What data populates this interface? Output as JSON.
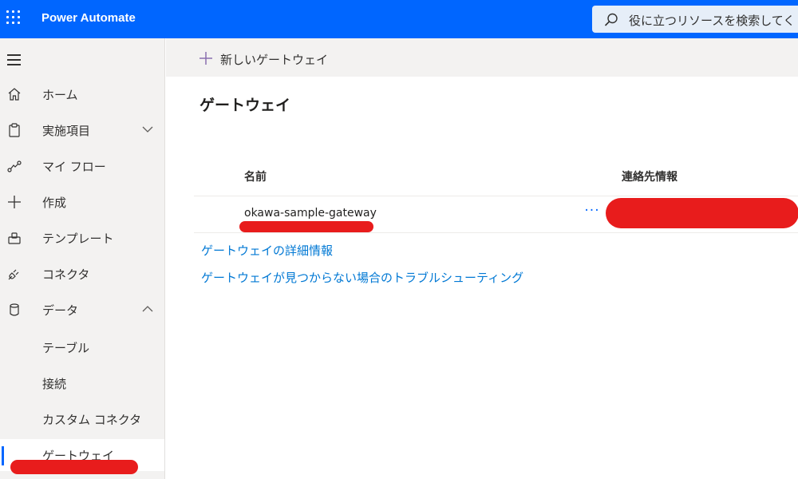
{
  "app": {
    "title": "Power Automate"
  },
  "search": {
    "placeholder": "役に立つリソースを検索してく"
  },
  "sidebar": {
    "items": [
      {
        "label": "ホーム"
      },
      {
        "label": "実施項目"
      },
      {
        "label": "マイ フロー"
      },
      {
        "label": "作成"
      },
      {
        "label": "テンプレート"
      },
      {
        "label": "コネクタ"
      },
      {
        "label": "データ"
      },
      {
        "label": "テーブル"
      },
      {
        "label": "接続"
      },
      {
        "label": "カスタム コネクタ"
      },
      {
        "label": "ゲートウェイ"
      }
    ]
  },
  "toolbar": {
    "new_gateway_label": "新しいゲートウェイ"
  },
  "main": {
    "title": "ゲートウェイ",
    "columns": {
      "name": "名前",
      "contact": "連絡先情報"
    },
    "rows": [
      {
        "name": "okawa-sample-gateway",
        "more": "···"
      }
    ],
    "links": {
      "details": "ゲートウェイの詳細情報",
      "troubleshoot": "ゲートウェイが見つからない場合のトラブルシューティング"
    }
  },
  "colors": {
    "brand": "#0066ff",
    "link": "#0078d4",
    "redaction": "#e81c1c"
  }
}
